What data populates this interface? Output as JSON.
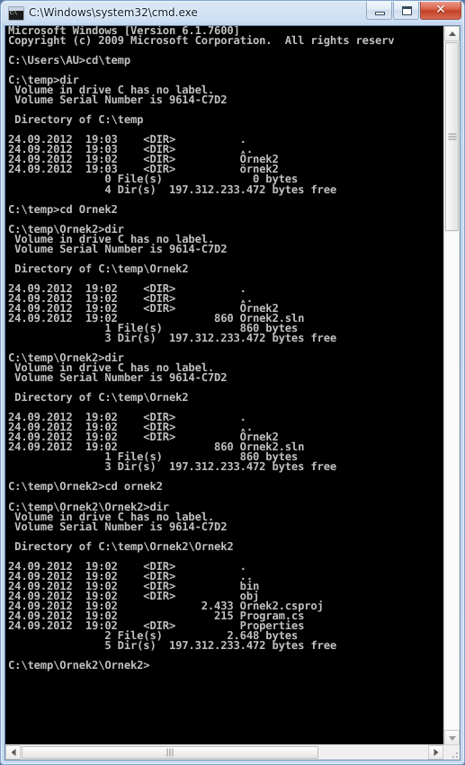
{
  "window": {
    "title": "C:\\Windows\\system32\\cmd.exe",
    "icon_name": "cmd-icon",
    "icon_label": "C:\\",
    "minimize_label": "",
    "maximize_label": "",
    "close_label": "✕"
  },
  "console": {
    "background": "#000000",
    "foreground": "#c0c0c0",
    "lines": [
      "Microsoft Windows [Version 6.1.7600]",
      "Copyright (c) 2009 Microsoft Corporation.  All rights reserv",
      "",
      "C:\\Users\\AU>cd\\temp",
      "",
      "C:\\temp>dir",
      " Volume in drive C has no label.",
      " Volume Serial Number is 9614-C7D2",
      "",
      " Directory of C:\\temp",
      "",
      "24.09.2012  19:03    <DIR>          .",
      "24.09.2012  19:03    <DIR>          ..",
      "24.09.2012  19:02    <DIR>          Örnek2",
      "24.09.2012  19:03    <DIR>          örnek2",
      "               0 File(s)              0 bytes",
      "               4 Dir(s)  197.312.233.472 bytes free",
      "",
      "C:\\temp>cd Ornek2",
      "",
      "C:\\temp\\Ornek2>dir",
      " Volume in drive C has no label.",
      " Volume Serial Number is 9614-C7D2",
      "",
      " Directory of C:\\temp\\Ornek2",
      "",
      "24.09.2012  19:02    <DIR>          .",
      "24.09.2012  19:02    <DIR>          ..",
      "24.09.2012  19:02    <DIR>          Örnek2",
      "24.09.2012  19:02               860 Ornek2.sln",
      "               1 File(s)            860 bytes",
      "               3 Dir(s)  197.312.233.472 bytes free",
      "",
      "C:\\temp\\Ornek2>dir",
      " Volume in drive C has no label.",
      " Volume Serial Number is 9614-C7D2",
      "",
      " Directory of C:\\temp\\Ornek2",
      "",
      "24.09.2012  19:02    <DIR>          .",
      "24.09.2012  19:02    <DIR>          ..",
      "24.09.2012  19:02    <DIR>          Örnek2",
      "24.09.2012  19:02               860 Ornek2.sln",
      "               1 File(s)            860 bytes",
      "               3 Dir(s)  197.312.233.472 bytes free",
      "",
      "C:\\temp\\Ornek2>cd ornek2",
      "",
      "C:\\temp\\Ornek2\\Ornek2>dir",
      " Volume in drive C has no label.",
      " Volume Serial Number is 9614-C7D2",
      "",
      " Directory of C:\\temp\\Ornek2\\Ornek2",
      "",
      "24.09.2012  19:02    <DIR>          .",
      "24.09.2012  19:02    <DIR>          ..",
      "24.09.2012  19:02    <DIR>          bin",
      "24.09.2012  19:02    <DIR>          obj",
      "24.09.2012  19:02             2.433 Ornek2.csproj",
      "24.09.2012  19:02               215 Program.cs",
      "24.09.2012  19:02    <DIR>          Properties",
      "               2 File(s)          2.648 bytes",
      "               5 Dir(s)  197.312.233.472 bytes free",
      "",
      "C:\\temp\\Ornek2\\Ornek2>"
    ]
  },
  "scrollbars": {
    "vertical": {
      "up_icon": "scroll-up-arrow-icon",
      "down_icon": "scroll-down-arrow-icon",
      "thumb_name": "vertical-scroll-thumb"
    },
    "horizontal": {
      "left_icon": "scroll-left-arrow-icon",
      "right_icon": "scroll-right-arrow-icon",
      "thumb_name": "horizontal-scroll-thumb"
    }
  }
}
